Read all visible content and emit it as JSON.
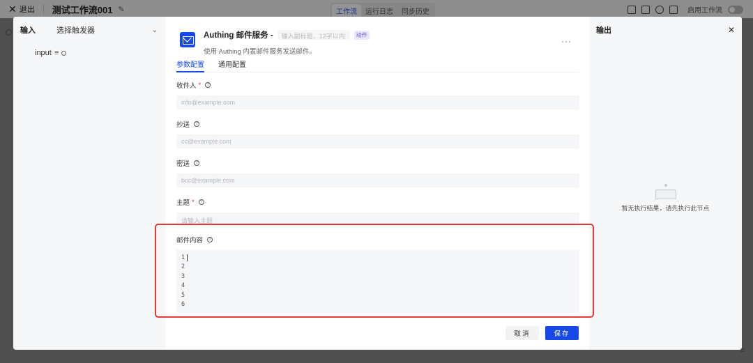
{
  "topbar": {
    "exit_label": "退出",
    "workflow_title": "测试工作流001",
    "tabs": [
      "工作流",
      "运行日志",
      "同步历史"
    ],
    "active_tab": 0,
    "enable_label": "启用工作流"
  },
  "left_panel": {
    "title": "输入",
    "trigger_select": "选择触发器",
    "input_param": "input"
  },
  "node": {
    "title": "Authing 邮件服务 -",
    "subtitle_placeholder": "输入副标题，12字以内",
    "tag": "动作",
    "description": "使用 Authing 内置邮件服务发送邮件。",
    "more": "···",
    "icon": "mail-icon"
  },
  "config_tabs": {
    "items": [
      "参数配置",
      "通用配置"
    ],
    "active": 0
  },
  "fields": {
    "recipient": {
      "label": "收件人",
      "required": true,
      "placeholder": "info@example.com"
    },
    "cc": {
      "label": "抄送",
      "required": false,
      "placeholder": "cc@example.com"
    },
    "bcc": {
      "label": "密送",
      "required": false,
      "placeholder": "bcc@example.com"
    },
    "subject": {
      "label": "主题",
      "required": true,
      "placeholder": "请输入主题"
    },
    "content": {
      "label": "邮件内容",
      "line_numbers": [
        "1",
        "2",
        "3",
        "4",
        "5",
        "6"
      ]
    }
  },
  "buttons": {
    "cancel": "取消",
    "save": "保存"
  },
  "right_panel": {
    "title": "输出",
    "empty_text": "暂无执行结果，请先执行此节点"
  },
  "colors": {
    "accent": "#1749e6",
    "highlight": "#e53935",
    "tag_text": "#6b4fd8"
  }
}
